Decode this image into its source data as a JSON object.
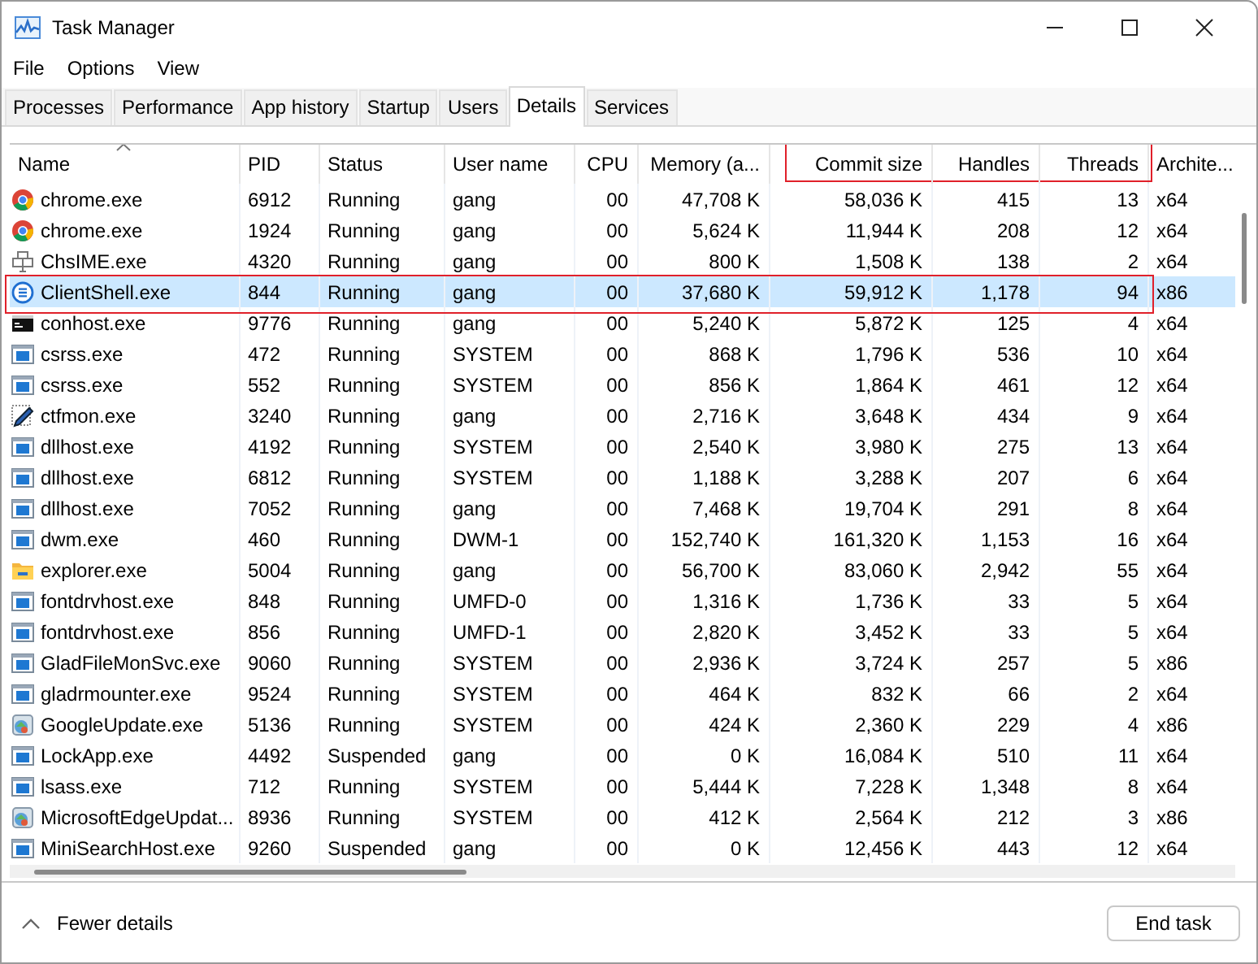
{
  "window": {
    "title": "Task Manager"
  },
  "menu": [
    "File",
    "Options",
    "View"
  ],
  "tabs": [
    {
      "label": "Processes",
      "selected": false
    },
    {
      "label": "Performance",
      "selected": false
    },
    {
      "label": "App history",
      "selected": false
    },
    {
      "label": "Startup",
      "selected": false
    },
    {
      "label": "Users",
      "selected": false
    },
    {
      "label": "Details",
      "selected": true
    },
    {
      "label": "Services",
      "selected": false
    }
  ],
  "table": {
    "columns": [
      {
        "label": "Name",
        "sorted": true,
        "outlined": false
      },
      {
        "label": "PID",
        "sorted": false,
        "outlined": false
      },
      {
        "label": "Status",
        "sorted": false,
        "outlined": false
      },
      {
        "label": "User name",
        "sorted": false,
        "outlined": false
      },
      {
        "label": "CPU",
        "sorted": false,
        "outlined": false
      },
      {
        "label": "Memory (a...",
        "sorted": false,
        "outlined": false
      },
      {
        "label": "Commit size",
        "sorted": false,
        "outlined": true
      },
      {
        "label": "Handles",
        "sorted": false,
        "outlined": true
      },
      {
        "label": "Threads",
        "sorted": false,
        "outlined": true
      },
      {
        "label": "Archite...",
        "sorted": false,
        "outlined": false
      }
    ],
    "rows": [
      {
        "kind": "chrome",
        "selected": false,
        "outlined": false,
        "cells": [
          "chrome.exe",
          "6912",
          "Running",
          "gang",
          "00",
          "47,708 K",
          "58,036 K",
          "415",
          "13",
          "x64"
        ]
      },
      {
        "kind": "chrome",
        "selected": false,
        "outlined": false,
        "cells": [
          "chrome.exe",
          "1924",
          "Running",
          "gang",
          "00",
          "5,624 K",
          "11,944 K",
          "208",
          "12",
          "x64"
        ]
      },
      {
        "kind": "ime",
        "selected": false,
        "outlined": false,
        "cells": [
          "ChsIME.exe",
          "4320",
          "Running",
          "gang",
          "00",
          "800 K",
          "1,508 K",
          "138",
          "2",
          "x64"
        ]
      },
      {
        "kind": "list",
        "selected": true,
        "outlined": true,
        "cells": [
          "ClientShell.exe",
          "844",
          "Running",
          "gang",
          "00",
          "37,680 K",
          "59,912 K",
          "1,178",
          "94",
          "x86"
        ]
      },
      {
        "kind": "console",
        "selected": false,
        "outlined": false,
        "cells": [
          "conhost.exe",
          "9776",
          "Running",
          "gang",
          "00",
          "5,240 K",
          "5,872 K",
          "125",
          "4",
          "x64"
        ]
      },
      {
        "kind": "window",
        "selected": false,
        "outlined": false,
        "cells": [
          "csrss.exe",
          "472",
          "Running",
          "SYSTEM",
          "00",
          "868 K",
          "1,796 K",
          "536",
          "10",
          "x64"
        ]
      },
      {
        "kind": "window",
        "selected": false,
        "outlined": false,
        "cells": [
          "csrss.exe",
          "552",
          "Running",
          "SYSTEM",
          "00",
          "856 K",
          "1,864 K",
          "461",
          "12",
          "x64"
        ]
      },
      {
        "kind": "pen",
        "selected": false,
        "outlined": false,
        "cells": [
          "ctfmon.exe",
          "3240",
          "Running",
          "gang",
          "00",
          "2,716 K",
          "3,648 K",
          "434",
          "9",
          "x64"
        ]
      },
      {
        "kind": "window",
        "selected": false,
        "outlined": false,
        "cells": [
          "dllhost.exe",
          "4192",
          "Running",
          "SYSTEM",
          "00",
          "2,540 K",
          "3,980 K",
          "275",
          "13",
          "x64"
        ]
      },
      {
        "kind": "window",
        "selected": false,
        "outlined": false,
        "cells": [
          "dllhost.exe",
          "6812",
          "Running",
          "SYSTEM",
          "00",
          "1,188 K",
          "3,288 K",
          "207",
          "6",
          "x64"
        ]
      },
      {
        "kind": "window",
        "selected": false,
        "outlined": false,
        "cells": [
          "dllhost.exe",
          "7052",
          "Running",
          "gang",
          "00",
          "7,468 K",
          "19,704 K",
          "291",
          "8",
          "x64"
        ]
      },
      {
        "kind": "window",
        "selected": false,
        "outlined": false,
        "cells": [
          "dwm.exe",
          "460",
          "Running",
          "DWM-1",
          "00",
          "152,740 K",
          "161,320 K",
          "1,153",
          "16",
          "x64"
        ]
      },
      {
        "kind": "folder",
        "selected": false,
        "outlined": false,
        "cells": [
          "explorer.exe",
          "5004",
          "Running",
          "gang",
          "00",
          "56,700 K",
          "83,060 K",
          "2,942",
          "55",
          "x64"
        ]
      },
      {
        "kind": "window",
        "selected": false,
        "outlined": false,
        "cells": [
          "fontdrvhost.exe",
          "848",
          "Running",
          "UMFD-0",
          "00",
          "1,316 K",
          "1,736 K",
          "33",
          "5",
          "x64"
        ]
      },
      {
        "kind": "window",
        "selected": false,
        "outlined": false,
        "cells": [
          "fontdrvhost.exe",
          "856",
          "Running",
          "UMFD-1",
          "00",
          "2,820 K",
          "3,452 K",
          "33",
          "5",
          "x64"
        ]
      },
      {
        "kind": "window",
        "selected": false,
        "outlined": false,
        "cells": [
          "GladFileMonSvc.exe",
          "9060",
          "Running",
          "SYSTEM",
          "00",
          "2,936 K",
          "3,724 K",
          "257",
          "5",
          "x86"
        ]
      },
      {
        "kind": "window",
        "selected": false,
        "outlined": false,
        "cells": [
          "gladrmounter.exe",
          "9524",
          "Running",
          "SYSTEM",
          "00",
          "464 K",
          "832 K",
          "66",
          "2",
          "x64"
        ]
      },
      {
        "kind": "installer",
        "selected": false,
        "outlined": false,
        "cells": [
          "GoogleUpdate.exe",
          "5136",
          "Running",
          "SYSTEM",
          "00",
          "424 K",
          "2,360 K",
          "229",
          "4",
          "x86"
        ]
      },
      {
        "kind": "window",
        "selected": false,
        "outlined": false,
        "cells": [
          "LockApp.exe",
          "4492",
          "Suspended",
          "gang",
          "00",
          "0 K",
          "16,084 K",
          "510",
          "11",
          "x64"
        ]
      },
      {
        "kind": "window",
        "selected": false,
        "outlined": false,
        "cells": [
          "lsass.exe",
          "712",
          "Running",
          "SYSTEM",
          "00",
          "5,444 K",
          "7,228 K",
          "1,348",
          "8",
          "x64"
        ]
      },
      {
        "kind": "installer",
        "selected": false,
        "outlined": false,
        "cells": [
          "MicrosoftEdgeUpdat...",
          "8936",
          "Running",
          "SYSTEM",
          "00",
          "412 K",
          "2,564 K",
          "212",
          "3",
          "x86"
        ]
      },
      {
        "kind": "window",
        "selected": false,
        "outlined": false,
        "cells": [
          "MiniSearchHost.exe",
          "9260",
          "Suspended",
          "gang",
          "00",
          "0 K",
          "12,456 K",
          "443",
          "12",
          "x64"
        ]
      }
    ]
  },
  "footer": {
    "toggle": "Fewer details",
    "button": "End task"
  }
}
